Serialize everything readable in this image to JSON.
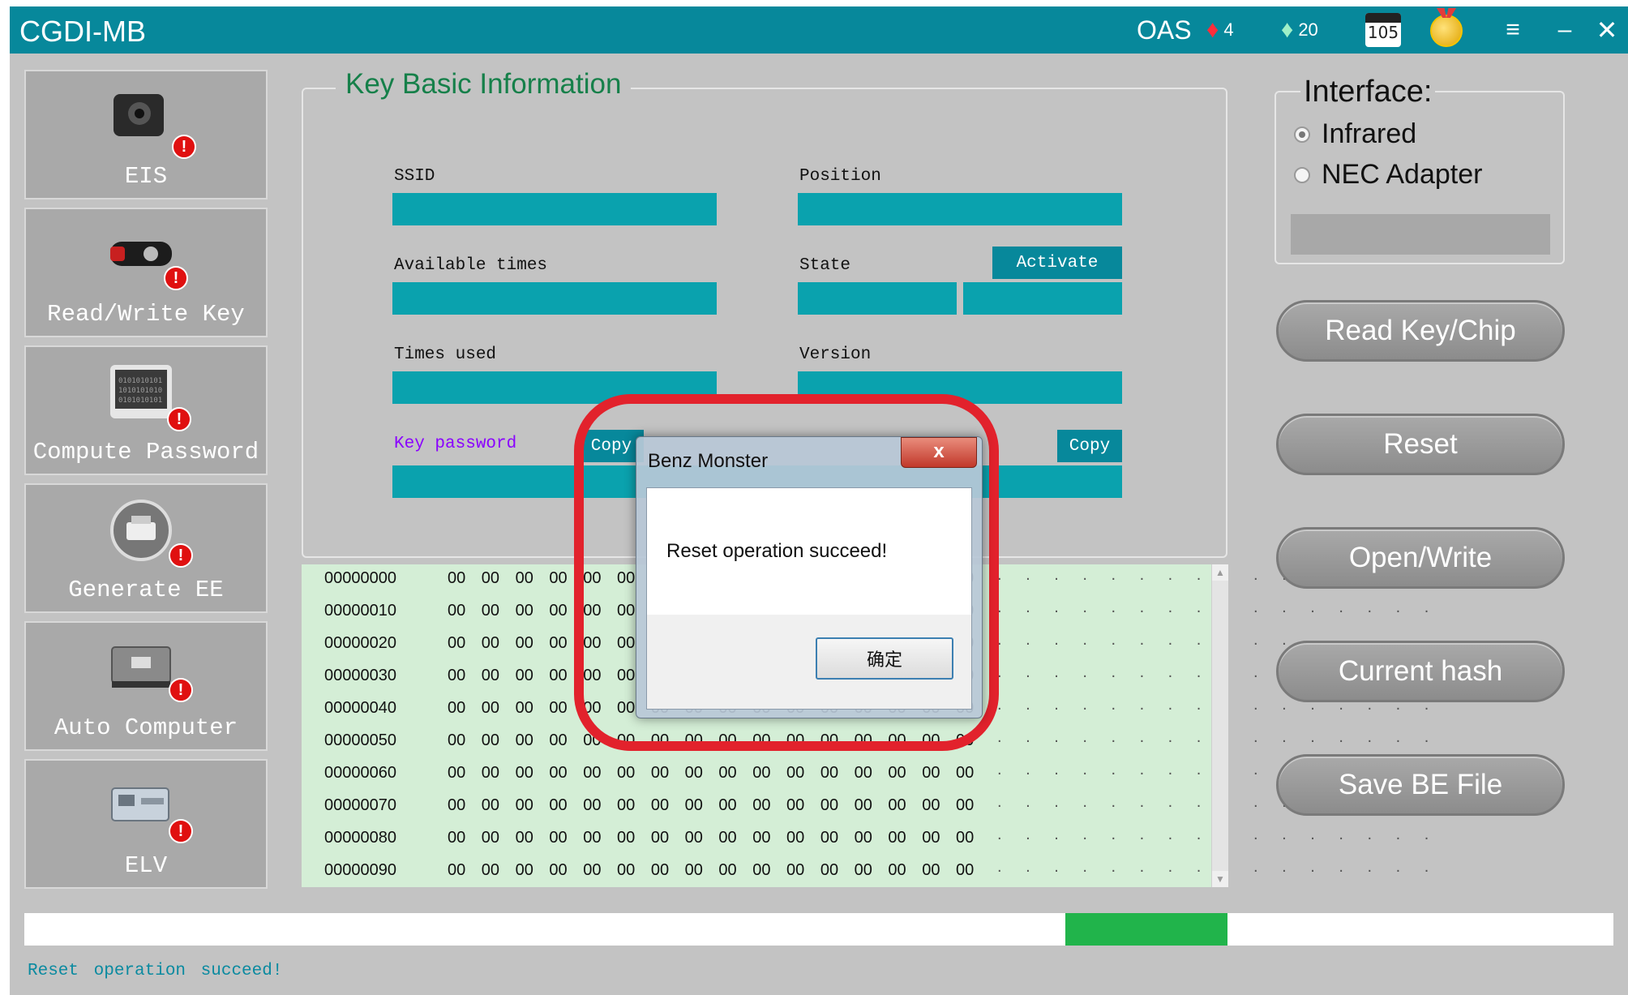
{
  "window": {
    "title": "CGDI-MB",
    "oas_label": "OAS",
    "ruby_count": "4",
    "emerald_count": "20",
    "calendar_value": "105",
    "menu_glyph": "≡",
    "minimize_glyph": "–",
    "close_glyph": "✕"
  },
  "sidebar": {
    "items": [
      {
        "label": "EIS",
        "icon": "ignition-switch-icon"
      },
      {
        "label": "Read/Write Key",
        "icon": "car-key-icon"
      },
      {
        "label": "Compute Password",
        "icon": "binary-chip-icon"
      },
      {
        "label": "Generate EE",
        "icon": "printer-badge-icon"
      },
      {
        "label": "Auto Computer",
        "icon": "ecu-module-icon"
      },
      {
        "label": "ELV",
        "icon": "steering-lock-icon"
      }
    ],
    "warning_glyph": "!"
  },
  "key_info": {
    "title": "Key Basic Information",
    "ssid_label": "SSID",
    "position_label": "Position",
    "available_label": "Available times",
    "state_label": "State",
    "activate_label": "Activate",
    "times_used_label": "Times used",
    "version_label": "Version",
    "key_password_label": "Key password",
    "copy_label": "Copy",
    "copy2_label": "Copy"
  },
  "hex_dump": {
    "rows": [
      {
        "addr": "00000000",
        "bytes": "00 00 00 00 00 00 00 00 00 00 00 00 00 00 00 00",
        "ascii": ". . . . . . . . . . . . . . . ."
      },
      {
        "addr": "00000010",
        "bytes": "00 00 00 00 00 00 00 00 00 00 00 00 00 00 00 00",
        "ascii": ". . . . . . . . . . . . . . . ."
      },
      {
        "addr": "00000020",
        "bytes": "00 00 00 00 00 00 00 00 00 00 00 00 00 00 00 00",
        "ascii": ". . . . . . . . . . . . . . . ."
      },
      {
        "addr": "00000030",
        "bytes": "00 00 00 00 00 00 00 00 00 00 00 00 00 00 00 00",
        "ascii": ". . . . . . . . . . . . . . . ."
      },
      {
        "addr": "00000040",
        "bytes": "00 00 00 00 00 00 00 00 00 00 00 00 00 00 00 00",
        "ascii": ". . . . . . . . . . . . . . . ."
      },
      {
        "addr": "00000050",
        "bytes": "00 00 00 00 00 00 00 00 00 00 00 00 00 00 00 00",
        "ascii": ". . . . . . . . . . . . . . . ."
      },
      {
        "addr": "00000060",
        "bytes": "00 00 00 00 00 00 00 00 00 00 00 00 00 00 00 00",
        "ascii": ". . . . . . . . . . . . . . . ."
      },
      {
        "addr": "00000070",
        "bytes": "00 00 00 00 00 00 00 00 00 00 00 00 00 00 00 00",
        "ascii": ". . . . . . . . . . . . . . . ."
      },
      {
        "addr": "00000080",
        "bytes": "00 00 00 00 00 00 00 00 00 00 00 00 00 00 00 00",
        "ascii": ". . . . . . . . . . . . . . . ."
      },
      {
        "addr": "00000090",
        "bytes": "00 00 00 00 00 00 00 00 00 00 00 00 00 00 00 00",
        "ascii": ". . . . . . . . . . . . . . . ."
      }
    ]
  },
  "interface": {
    "title": "Interface:",
    "options": [
      {
        "label": "Infrared",
        "selected": true
      },
      {
        "label": "NEC Adapter",
        "selected": false
      }
    ]
  },
  "actions": {
    "read_key": "Read Key/Chip",
    "reset": "Reset",
    "open_write": "Open/Write",
    "current_hash": "Current hash",
    "save_be": "Save BE File"
  },
  "status": {
    "message": "Reset operation succeed!",
    "progress_fill_color": "#21b44b"
  },
  "dialog": {
    "title": "Benz Monster",
    "message": "Reset operation succeed!",
    "ok_label": "确定",
    "close_glyph": "x"
  },
  "colors": {
    "titlebar": "#07889b",
    "field": "#0aa2ae",
    "highlight": "#e2222c"
  }
}
